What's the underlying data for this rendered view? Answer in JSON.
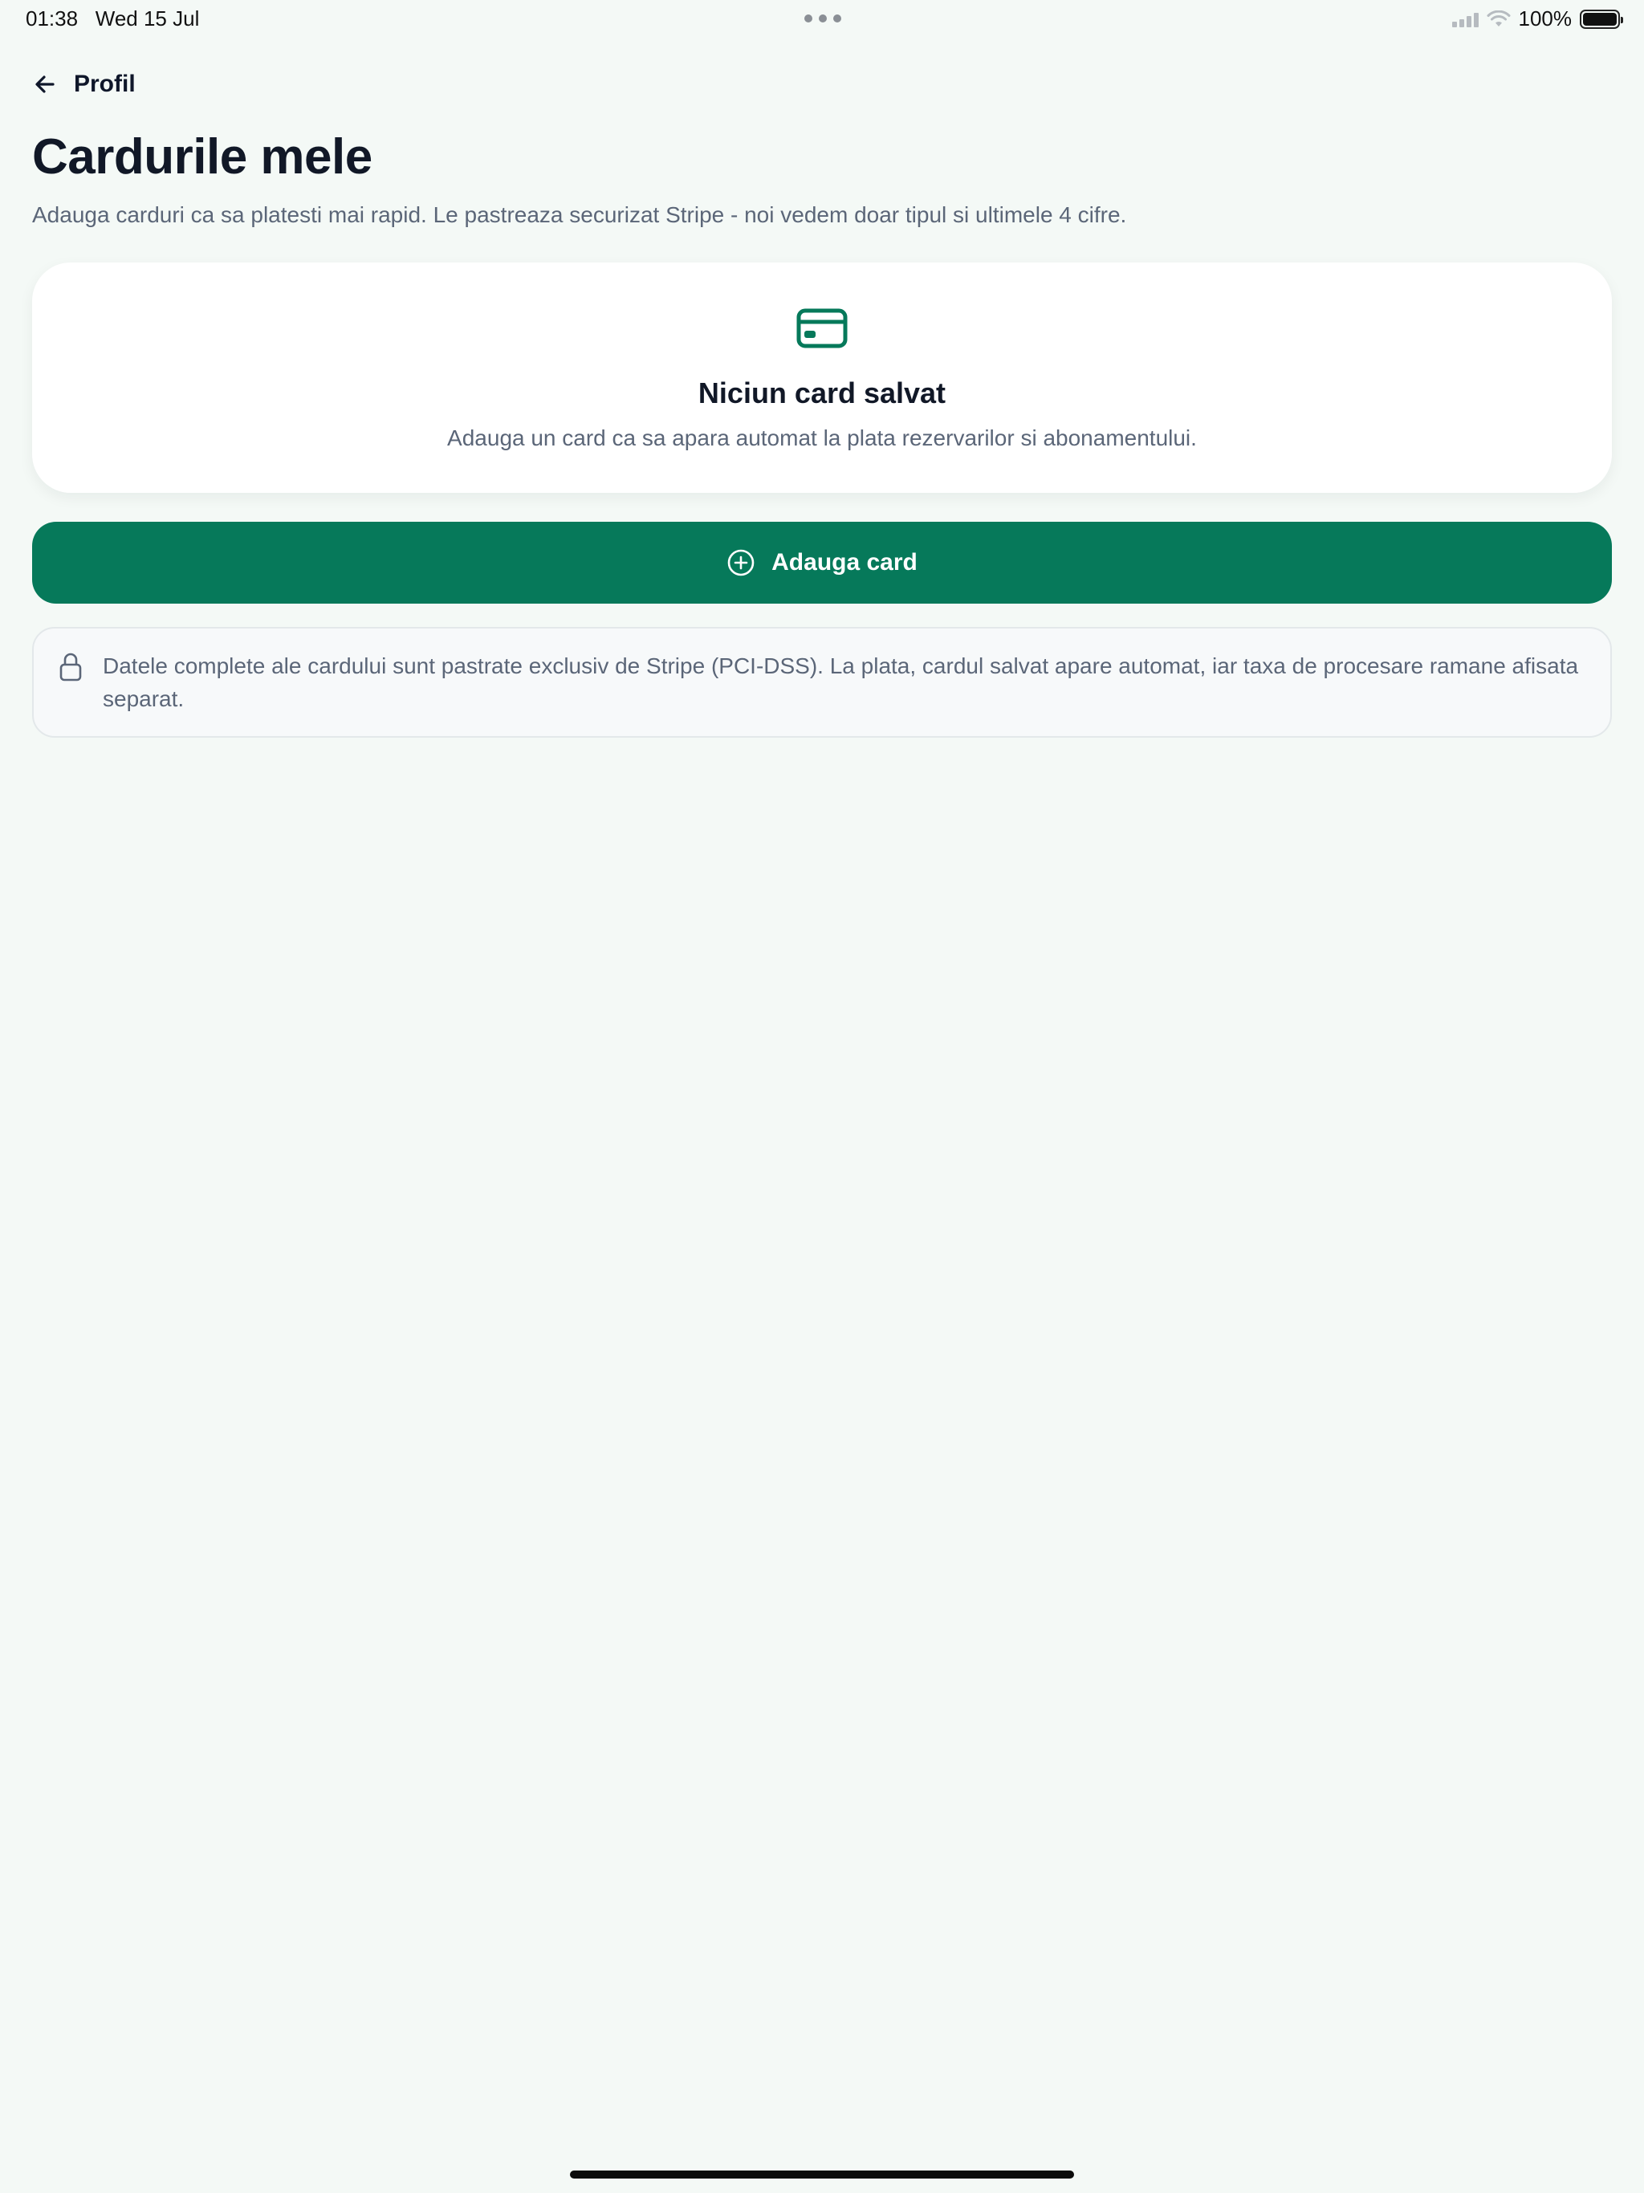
{
  "status_bar": {
    "time": "01:38",
    "date": "Wed 15 Jul",
    "battery": "100%"
  },
  "header": {
    "back_label": "Profil",
    "title": "Cardurile mele",
    "subtitle": "Adauga carduri ca sa platesti mai rapid. Le pastreaza securizat Stripe - noi vedem doar tipul si ultimele 4 cifre."
  },
  "empty_state": {
    "icon": "credit-card-icon",
    "title": "Niciun card salvat",
    "description": "Adauga un card ca sa apara automat la plata rezervarilor si abonamentului."
  },
  "add_button": {
    "icon": "plus-circle-icon",
    "label": "Adauga card"
  },
  "info": {
    "icon": "lock-icon",
    "text": "Datele complete ale cardului sunt pastrate exclusiv de Stripe (PCI-DSS). La plata, cardul salvat apare automat, iar taxa de procesare ramane afisata separat."
  },
  "colors": {
    "background": "#f4f9f6",
    "accent": "#06795a",
    "title": "#111827",
    "muted_text": "#5b6678"
  }
}
